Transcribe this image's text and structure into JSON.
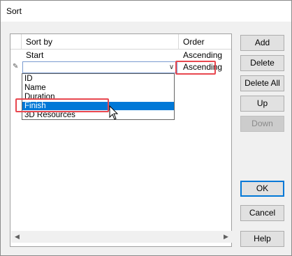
{
  "window": {
    "title": "Sort"
  },
  "grid": {
    "columns": {
      "sort_by": "Sort by",
      "order": "Order"
    },
    "rows": [
      {
        "sort_by": "Start",
        "order": "Ascending"
      },
      {
        "sort_by": "",
        "order": "Ascending",
        "editing": true
      }
    ],
    "combo_arrow_icon": "chevron-down-icon",
    "pencil_icon": "pencil-icon",
    "dropdown_options": [
      "ID",
      "Name",
      "Duration",
      "Finish",
      "3D Resources"
    ],
    "selected_option": "Finish"
  },
  "buttons": {
    "add": "Add",
    "delete": "Delete",
    "delete_all": "Delete All",
    "up": "Up",
    "down": "Down",
    "ok": "OK",
    "cancel": "Cancel",
    "help": "Help"
  },
  "colors": {
    "highlight_blue": "#0078d7",
    "annotation_red": "#e8474f"
  }
}
